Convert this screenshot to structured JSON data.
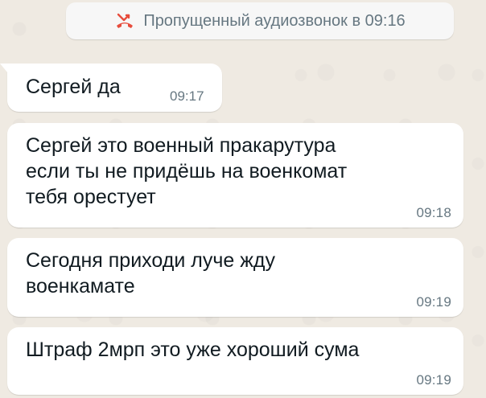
{
  "system_message": {
    "icon": "missed-call-icon",
    "icon_color": "#e74c3c",
    "text": "Пропущенный аудиозвонок в 09:16"
  },
  "messages": [
    {
      "text": "Сергей да",
      "time": "09:17"
    },
    {
      "text": "Сергей это военный пракарутура\nесли ты не придёшь на военкомат\nтебя орестует",
      "time": "09:18"
    },
    {
      "text": "Сегодня приходи луче жду\nвоенкамате",
      "time": "09:19"
    },
    {
      "text": "Штраф 2мрп это уже хороший сума",
      "time": "09:19"
    }
  ],
  "colors": {
    "bubble_background": "#ffffff",
    "chat_background": "#efeae2",
    "timestamp": "#667781"
  }
}
